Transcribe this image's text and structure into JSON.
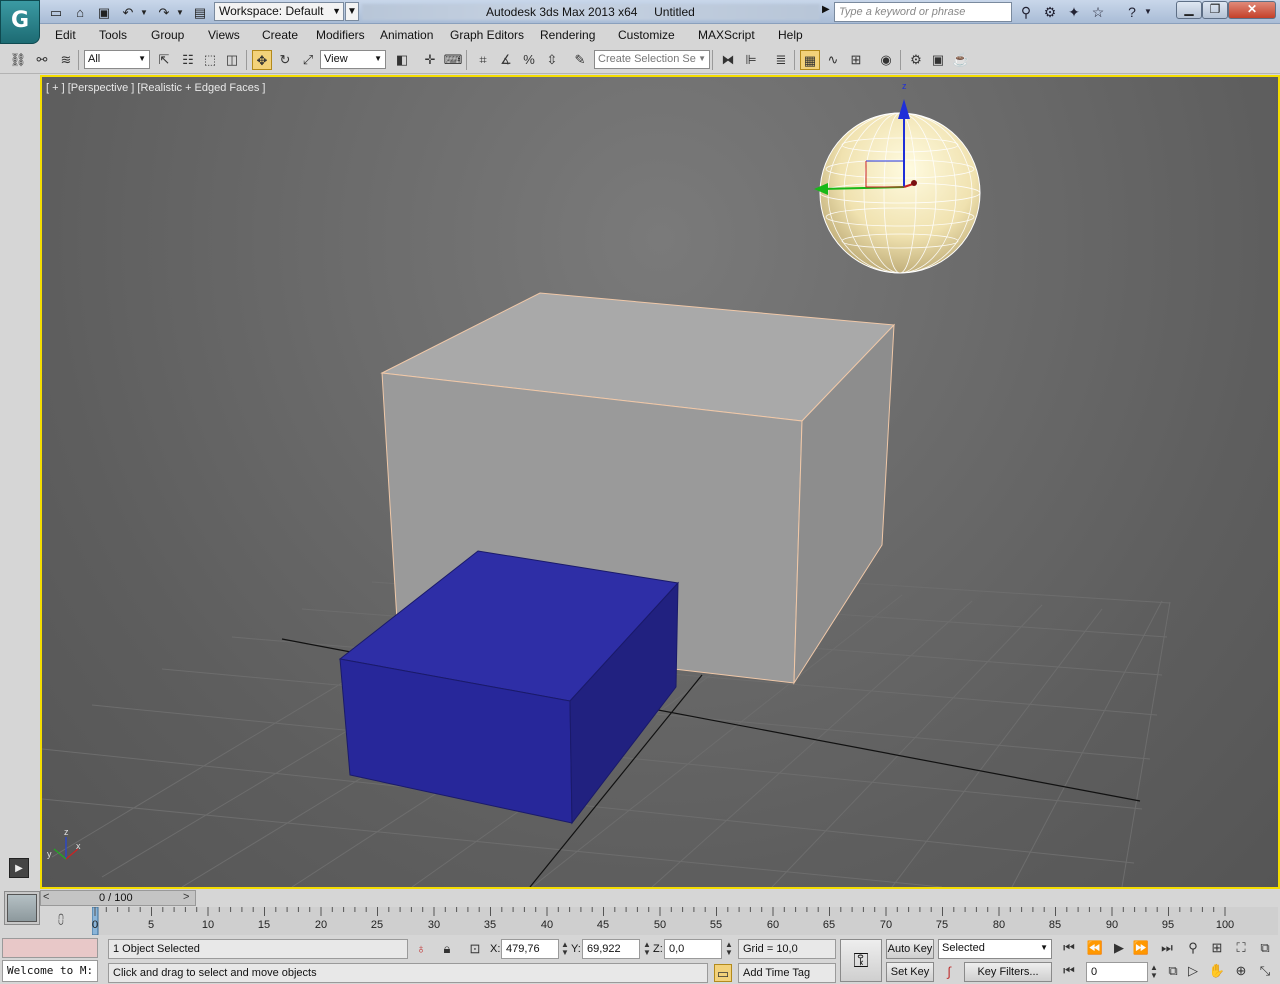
{
  "titlebar": {
    "workspace": "Workspace: Default",
    "app_title": "Autodesk 3ds Max  2013 x64",
    "doc_title": "Untitled",
    "search_placeholder": "Type a keyword or phrase",
    "logo_glyph": "G"
  },
  "menu": [
    "Edit",
    "Tools",
    "Group",
    "Views",
    "Create",
    "Modifiers",
    "Animation",
    "Graph Editors",
    "Rendering",
    "Customize",
    "MAXScript",
    "Help"
  ],
  "toolbar": {
    "selection_filter": "All",
    "reference_coord": "View",
    "selection_set_placeholder": "Create Selection Se"
  },
  "viewport": {
    "label": "[ + ] [Perspective ] [Realistic + Edged Faces ]",
    "axis_x": "x",
    "axis_y": "y",
    "axis_z": "z",
    "objects": [
      {
        "name": "Box001",
        "color": "#a8a8a8"
      },
      {
        "name": "Box002",
        "color": "#2a2aa8"
      },
      {
        "name": "Sphere001",
        "color": "#f0e2b0"
      }
    ]
  },
  "timeline": {
    "slider_label": "0 / 100",
    "ticks": [
      "0",
      "5",
      "10",
      "15",
      "20",
      "25",
      "30",
      "35",
      "40",
      "45",
      "50",
      "55",
      "60",
      "65",
      "70",
      "75",
      "80",
      "85",
      "90",
      "95",
      "100"
    ]
  },
  "status": {
    "listener": "Welcome to M:",
    "selection_info": "1 Object Selected",
    "prompt": "Click and drag to select and move objects",
    "x_label": "X:",
    "x_value": "479,76",
    "y_label": "Y:",
    "y_value": "69,922",
    "z_label": "Z:",
    "z_value": "0,0",
    "grid": "Grid = 10,0",
    "add_time_tag": "Add Time Tag",
    "auto_key": "Auto Key",
    "set_key": "Set Key",
    "key_mode": "Selected",
    "key_filters": "Key Filters...",
    "frame": "0"
  }
}
